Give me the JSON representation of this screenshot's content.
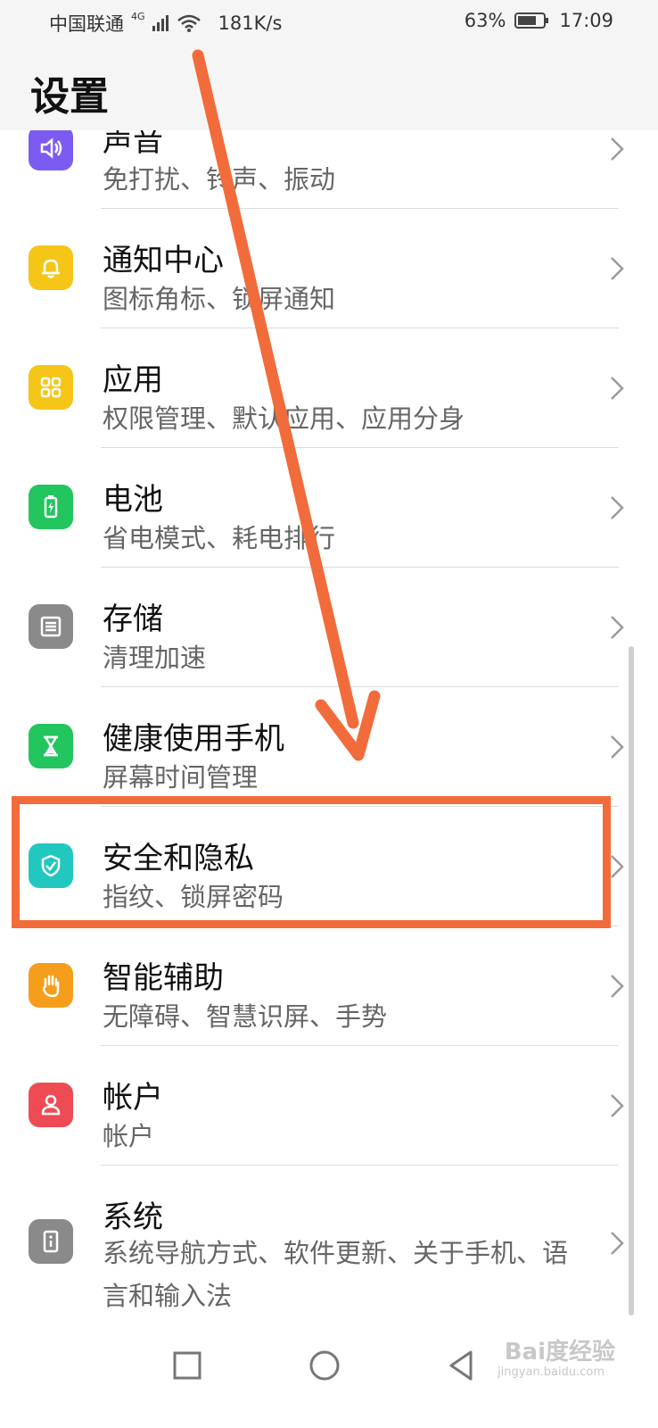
{
  "status_bar": {
    "carrier": "中国联通",
    "network": "4G",
    "speed": "181K/s",
    "battery": "63%",
    "time": "17:09"
  },
  "header": {
    "title": "设置"
  },
  "items": [
    {
      "title": "声音",
      "subtitle": "免打扰、铃声、振动",
      "icon": "volume-icon",
      "color": "#7c5cf0"
    },
    {
      "title": "通知中心",
      "subtitle": "图标角标、锁屏通知",
      "icon": "bell-icon",
      "color": "#f5c518"
    },
    {
      "title": "应用",
      "subtitle": "权限管理、默认应用、应用分身",
      "icon": "apps-grid-icon",
      "color": "#f5c518"
    },
    {
      "title": "电池",
      "subtitle": "省电模式、耗电排行",
      "icon": "battery-icon",
      "color": "#22c55e"
    },
    {
      "title": "存储",
      "subtitle": "清理加速",
      "icon": "storage-icon",
      "color": "#8a8a8a"
    },
    {
      "title": "健康使用手机",
      "subtitle": "屏幕时间管理",
      "icon": "hourglass-icon",
      "color": "#22c55e"
    },
    {
      "title": "安全和隐私",
      "subtitle": "指纹、锁屏密码",
      "icon": "shield-icon",
      "color": "#22c7c0"
    },
    {
      "title": "智能辅助",
      "subtitle": "无障碍、智慧识屏、手势",
      "icon": "hand-icon",
      "color": "#f59e1b"
    },
    {
      "title": "帐户",
      "subtitle": "帐户",
      "icon": "user-icon",
      "color": "#ef4b55"
    },
    {
      "title": "系统",
      "subtitle": "系统导航方式、软件更新、关于手机、语言和输入法",
      "icon": "info-icon",
      "color": "#8a8a8a"
    }
  ],
  "annotation": {
    "highlight_color": "#f26b3a"
  },
  "watermark": {
    "text": "Bai度经验",
    "sub": "jingyan.baidu.com"
  }
}
